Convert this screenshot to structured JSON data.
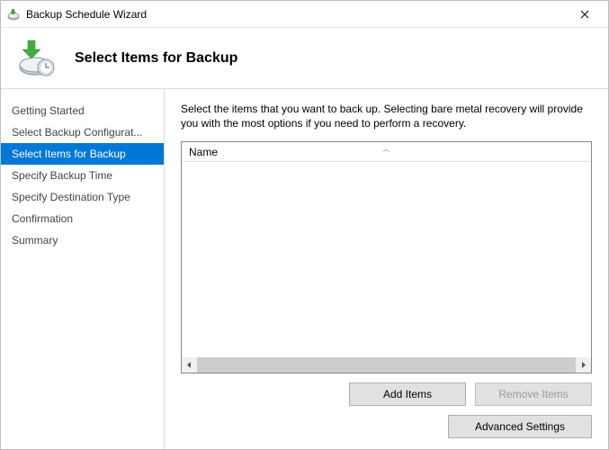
{
  "window": {
    "title": "Backup Schedule Wizard"
  },
  "header": {
    "page_title": "Select Items for Backup"
  },
  "sidebar": {
    "items": [
      {
        "label": "Getting Started",
        "active": false
      },
      {
        "label": "Select Backup Configurat...",
        "active": false
      },
      {
        "label": "Select Items for Backup",
        "active": true
      },
      {
        "label": "Specify Backup Time",
        "active": false
      },
      {
        "label": "Specify Destination Type",
        "active": false
      },
      {
        "label": "Confirmation",
        "active": false
      },
      {
        "label": "Summary",
        "active": false
      }
    ]
  },
  "main": {
    "instruction": "Select the items that you want to back up. Selecting bare metal recovery will provide you with the most options if you need to perform a recovery.",
    "list": {
      "columns": [
        {
          "label": "Name"
        }
      ],
      "rows": []
    },
    "buttons": {
      "add_items": "Add Items",
      "remove_items": "Remove Items",
      "advanced_settings": "Advanced Settings"
    }
  }
}
